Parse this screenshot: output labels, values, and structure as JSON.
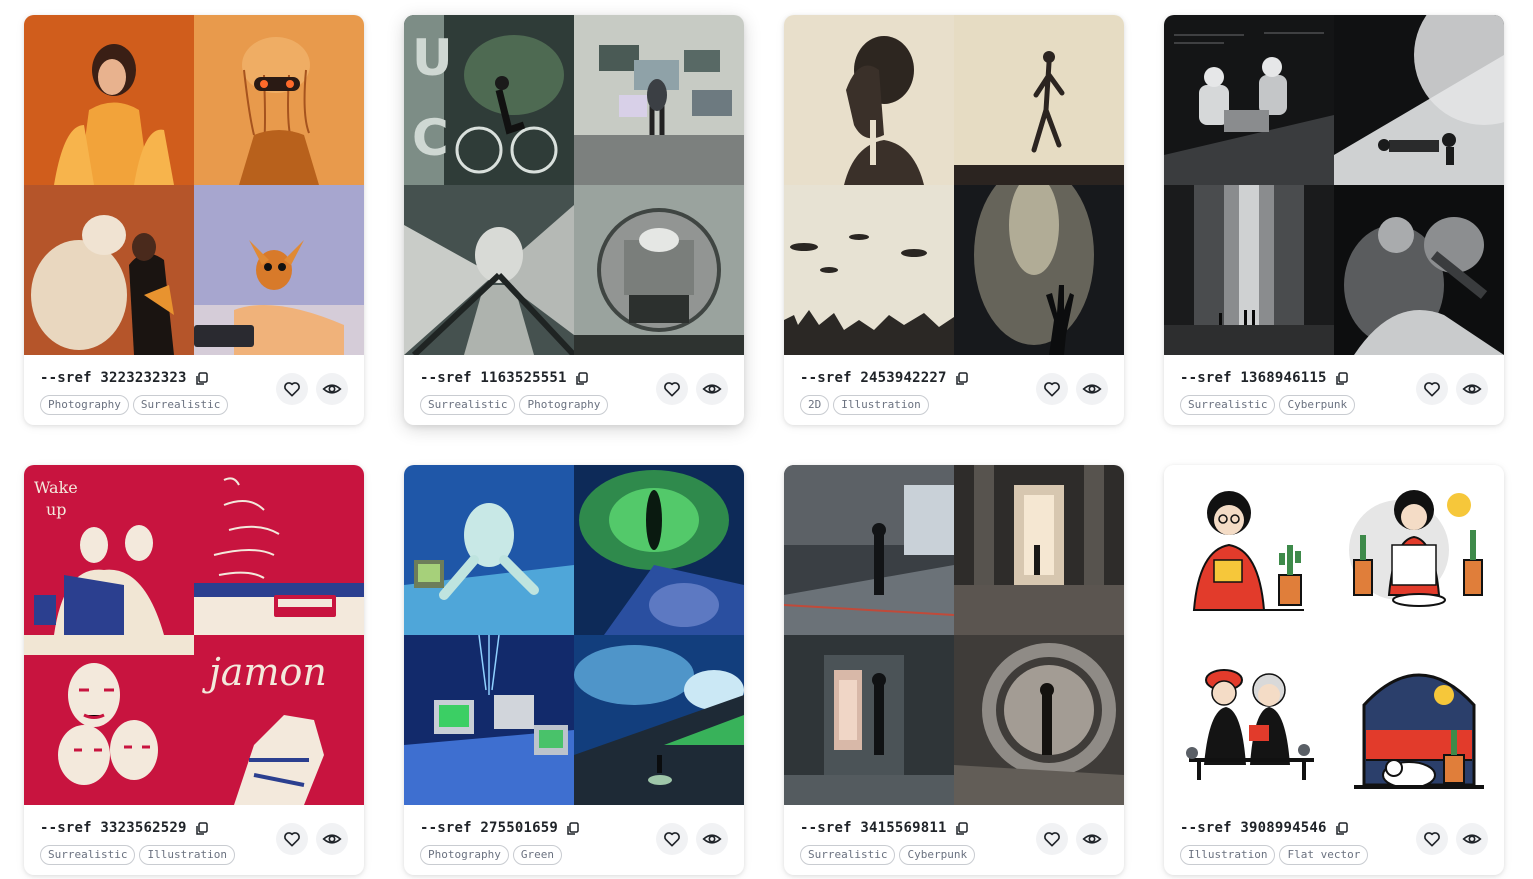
{
  "cards": [
    {
      "sref": "--sref 3223232323",
      "tags": [
        "Photography",
        "Surrealistic"
      ]
    },
    {
      "sref": "--sref 1163525551",
      "tags": [
        "Surrealistic",
        "Photography"
      ]
    },
    {
      "sref": "--sref 2453942227",
      "tags": [
        "2D",
        "Illustration"
      ]
    },
    {
      "sref": "--sref 1368946115",
      "tags": [
        "Surrealistic",
        "Cyberpunk"
      ]
    },
    {
      "sref": "--sref 3323562529",
      "tags": [
        "Surrealistic",
        "Illustration"
      ]
    },
    {
      "sref": "--sref 275501659",
      "tags": [
        "Photography",
        "Green"
      ]
    },
    {
      "sref": "--sref 3415569811",
      "tags": [
        "Surrealistic",
        "Cyberpunk"
      ]
    },
    {
      "sref": "--sref 3908994546",
      "tags": [
        "Illustration",
        "Flat vector"
      ]
    }
  ],
  "icons": {
    "copy": "copy-icon",
    "like": "heart-icon",
    "view": "eye-icon"
  },
  "colors": {
    "text": "#1f2328",
    "tag_text": "#6b7280",
    "tag_border": "#c9ccd1",
    "button_bg": "#f1f2f4"
  }
}
